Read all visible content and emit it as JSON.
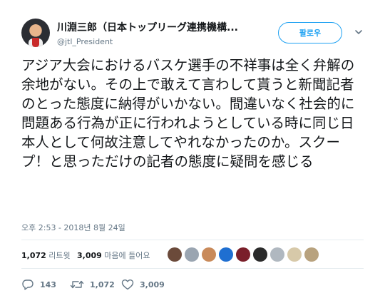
{
  "author": {
    "display_name": "川淵三郎（日本トップリーグ連携機構...",
    "handle": "@jtl_President"
  },
  "follow_button": {
    "label": "팔로우"
  },
  "tweet": {
    "text": "アジア大会におけるバスケ選手の不祥事は全く弁解の余地がない。その上で敢えて言わして貰うと新聞記者のとった態度に納得がいかない。間違いなく社会的に問題ある行為が正に行われようとしている時に同じ日本人として何故注意してやれなかったのか。スクープ！と思っただけの記者の態度に疑問を感じる",
    "timestamp": "오후 2:53 - 2018년 8월 24일"
  },
  "stats": {
    "retweets_count": "1,072",
    "retweets_label": "리트윗",
    "likes_count": "3,009",
    "likes_label": "마음에 들어요"
  },
  "likers": [
    {
      "icon": "avatar-icon",
      "color": "#6b4a3a"
    },
    {
      "icon": "avatar-icon",
      "color": "#9aa5b1"
    },
    {
      "icon": "avatar-icon",
      "color": "#c98a5a"
    },
    {
      "icon": "avatar-icon",
      "color": "#1f6fd1"
    },
    {
      "icon": "avatar-icon",
      "color": "#7a1f2a"
    },
    {
      "icon": "avatar-icon",
      "color": "#2b2b2b"
    },
    {
      "icon": "avatar-icon",
      "color": "#b0b8c0"
    },
    {
      "icon": "avatar-icon",
      "color": "#d7c9a9"
    },
    {
      "icon": "avatar-icon",
      "color": "#b8a27e"
    }
  ],
  "actions": {
    "replies": "143",
    "retweets": "1,072",
    "likes": "3,009"
  },
  "colors": {
    "accent": "#1da1f2",
    "text": "#14171a",
    "secondary": "#657786",
    "divider": "#e6ecf0"
  }
}
